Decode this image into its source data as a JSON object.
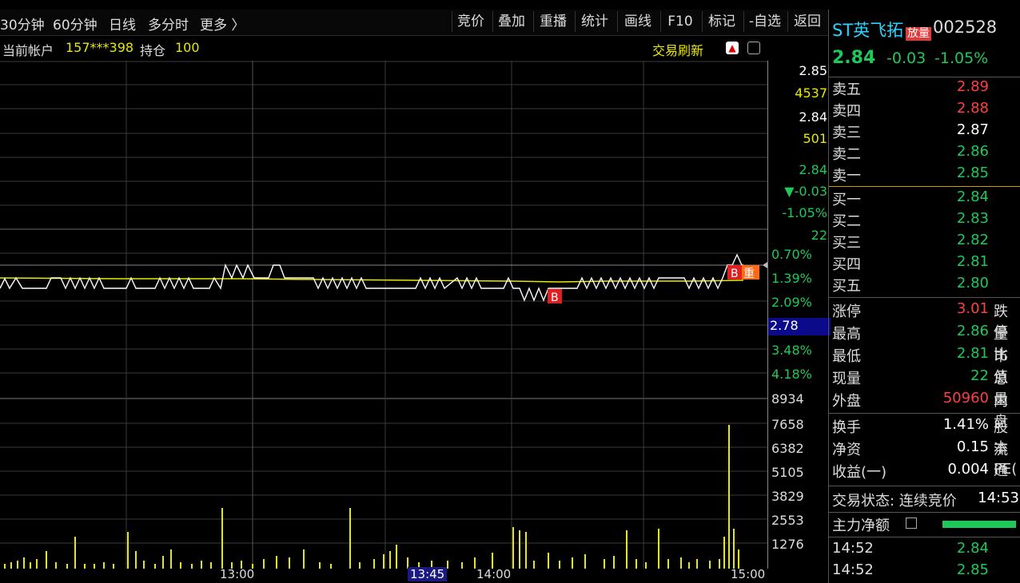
{
  "toolbar": {
    "periods": [
      "30分钟",
      "60分钟",
      "日线",
      "多分时",
      "更多 〉"
    ],
    "buttons": [
      "竞价",
      "叠加",
      "重播",
      "统计",
      "画线",
      "F10",
      "标记",
      "-自选",
      "返回"
    ]
  },
  "account": {
    "label": "当前帐户",
    "id": "157***398",
    "hold_label": "持仓",
    "hold_value": "100",
    "refresh": "交易刷新"
  },
  "scale": {
    "top_price": "2.85",
    "vol_a": "4537",
    "mid_price": "2.84",
    "vol_b": "501",
    "cur_price": "2.84",
    "chg": "▼-0.03",
    "chg_pct": "-1.05%",
    "cur_vol": "22",
    "pct_1": "0.70%",
    "pct_2": "1.39%",
    "pct_3": "2.09%",
    "low_price": "2.78",
    "pct_4": "3.48%",
    "pct_5": "4.18%",
    "vol_ticks": [
      "8934",
      "7658",
      "6382",
      "5105",
      "3829",
      "2553",
      "1276"
    ]
  },
  "x_axis": {
    "t1": "13:00",
    "t2": "13:45",
    "t3": "14:00",
    "t4": "15:00"
  },
  "markers": {
    "buy": "B",
    "heavy": "重"
  },
  "stock": {
    "name": "ST英飞拓",
    "badge": "放量",
    "code": "002528",
    "price": "2.84",
    "change": "-0.03",
    "change_pct": "-1.05%"
  },
  "orderbook": {
    "asks": [
      {
        "label": "卖五",
        "price": "2.89",
        "color": "#ff4040"
      },
      {
        "label": "卖四",
        "price": "2.88",
        "color": "#ff4040"
      },
      {
        "label": "卖三",
        "price": "2.87",
        "color": "#ffffff"
      },
      {
        "label": "卖二",
        "price": "2.86",
        "color": "#1ec95a"
      },
      {
        "label": "卖一",
        "price": "2.85",
        "color": "#1ec95a"
      }
    ],
    "bids": [
      {
        "label": "买一",
        "price": "2.84",
        "color": "#1ec95a"
      },
      {
        "label": "买二",
        "price": "2.83",
        "color": "#1ec95a"
      },
      {
        "label": "买三",
        "price": "2.82",
        "color": "#1ec95a"
      },
      {
        "label": "买四",
        "price": "2.81",
        "color": "#1ec95a"
      },
      {
        "label": "买五",
        "price": "2.80",
        "color": "#1ec95a"
      }
    ]
  },
  "stats": [
    {
      "k": "涨停",
      "v": "3.01",
      "k2": "跌停",
      "color": "#ff4040"
    },
    {
      "k": "最高",
      "v": "2.86",
      "k2": "量比",
      "color": "#1ec95a"
    },
    {
      "k": "最低",
      "v": "2.81",
      "k2": "市值",
      "color": "#1ec95a"
    },
    {
      "k": "现量",
      "v": "22",
      "k2": "总量",
      "color": "#1ec95a"
    },
    {
      "k": "外盘",
      "v": "50960",
      "k2": "内盘",
      "color": "#ff4040"
    }
  ],
  "stats2": [
    {
      "k": "换手",
      "v": "1.41%",
      "k2": "股本"
    },
    {
      "k": "净资",
      "v": "0.15",
      "k2": "流通"
    },
    {
      "k": "收益(一)",
      "v": "0.004",
      "k2": "PE("
    }
  ],
  "status": {
    "label": "交易状态: 连续竞价",
    "time": "14:53"
  },
  "net_flow": {
    "label": "主力净额"
  },
  "ticks": [
    {
      "time": "14:52",
      "price": "2.84"
    },
    {
      "time": "14:52",
      "price": "2.85"
    }
  ],
  "colors": {
    "up": "#ff4040",
    "down": "#1ec95a",
    "avg_line": "#e8e800",
    "price_line": "#ffffff"
  }
}
